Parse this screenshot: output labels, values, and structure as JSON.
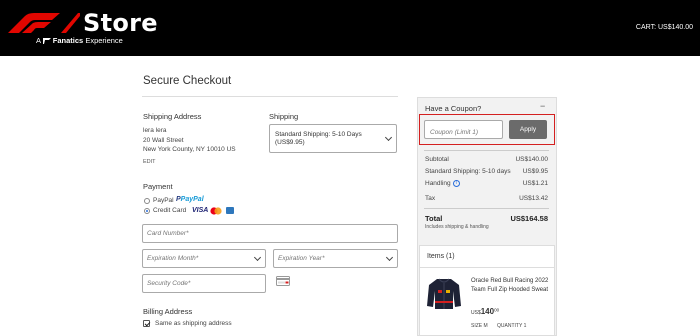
{
  "header": {
    "store_text": "Store",
    "tagline_prefix": "A",
    "tagline_brand": "Fanatics",
    "tagline_suffix": "Experience",
    "cart_text": "CART: US$140.00"
  },
  "checkout": {
    "title": "Secure Checkout",
    "shipping_address": {
      "heading": "Shipping Address",
      "name": "lera lera",
      "street": "20 Wall Street",
      "city": "New York County, NY 10010 US",
      "edit_label": "EDIT"
    },
    "shipping": {
      "heading": "Shipping",
      "selected_option": "Standard Shipping: 5-10 Days (US$9.95)"
    },
    "payment": {
      "heading": "Payment",
      "options": [
        {
          "label": "PayPal",
          "selected": false
        },
        {
          "label": "Credit Card",
          "selected": true
        }
      ],
      "card_brands": [
        "VISA",
        "Mastercard",
        "Amex"
      ],
      "paypal_brand": "PayPal"
    },
    "card_form": {
      "card_number_placeholder": "Card Number*",
      "exp_month_placeholder": "Expiration Month*",
      "exp_year_placeholder": "Expiration Year*",
      "cvv_placeholder": "Security Code*"
    },
    "billing": {
      "heading": "Billing Address",
      "same_as_shipping_label": "Same as shipping address",
      "same_as_shipping_checked": true
    }
  },
  "summary": {
    "coupon_heading": "Have a Coupon?",
    "coupon_collapse": "−",
    "coupon_placeholder": "Coupon (Limit 1)",
    "apply_label": "Apply",
    "rows": [
      {
        "label": "Subtotal",
        "value": "US$140.00"
      },
      {
        "label": "Standard Shipping: 5-10 days",
        "value": "US$9.95"
      },
      {
        "label": "Handling",
        "value": "US$1.21"
      },
      {
        "label": "Tax",
        "value": "US$13.42"
      }
    ],
    "info_icon_glyph": "i",
    "total_label": "Total",
    "total_value": "US$164.58",
    "total_sub": "Includes shipping & handling",
    "items_heading": "Items (1)",
    "item": {
      "name": "Oracle Red Bull Racing 2022 Team Full Zip Hooded Sweat",
      "price_currency": "US$",
      "price_whole": "140",
      "price_cents": "00",
      "size": "SIZE M",
      "quantity": "QUANTITY 1"
    }
  },
  "colors": {
    "header_bg": "#000000",
    "f1_red": "#e10600",
    "coupon_highlight": "#d42020",
    "apply_bg": "#6b6b6b"
  }
}
